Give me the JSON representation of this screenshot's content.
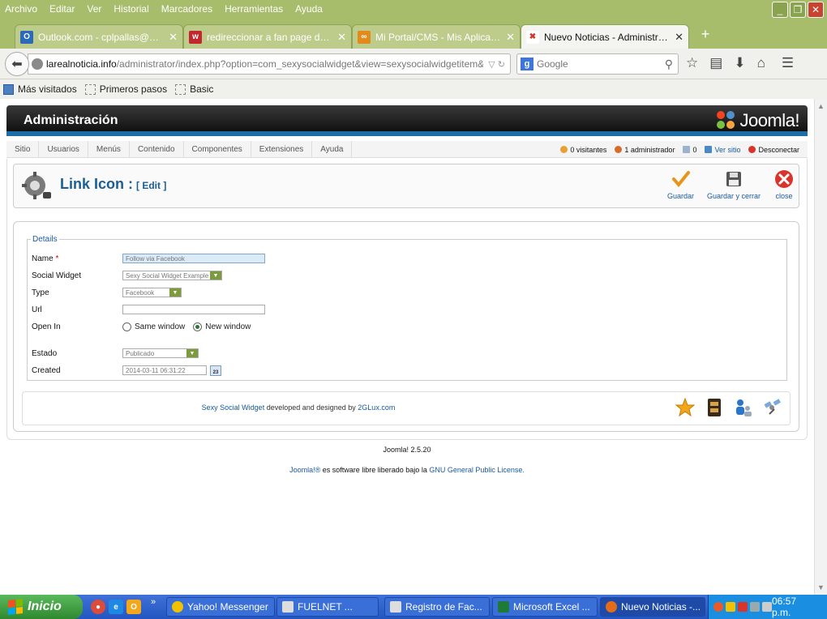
{
  "browser": {
    "menu": [
      "Archivo",
      "Editar",
      "Ver",
      "Historial",
      "Marcadores",
      "Herramientas",
      "Ayuda"
    ],
    "window_buttons": {
      "minimize": "_",
      "maximize": "❐",
      "close": "✕"
    },
    "tabs": [
      {
        "title": "Outlook.com - cplpallas@hot...",
        "icon_color": "#2a6ab8",
        "icon_text": "O"
      },
      {
        "title": "redireccionar a fan page desd...",
        "icon_color": "#c3282e",
        "icon_text": "w"
      },
      {
        "title": "Mi Portal/CMS - Mis Aplicacion...",
        "icon_color": "#e28a1c",
        "icon_text": "∞"
      },
      {
        "title": "Nuevo Noticias - Administraci...",
        "icon_color": "#ffffff",
        "icon_text": "✖"
      }
    ],
    "new_tab": "+",
    "url_host": "larealnoticia.info",
    "url_path": "/administrator/index.php?option=com_sexysocialwidget&view=sexysocialwidgetitem&layout=e",
    "search_placeholder": "Google",
    "bookmarks": [
      "Más visitados",
      "Primeros pasos",
      "Basic"
    ]
  },
  "joomla": {
    "header_title": "Administración",
    "logo_text": "Joomla!",
    "menu": [
      "Sitio",
      "Usuarios",
      "Menús",
      "Contenido",
      "Componentes",
      "Extensiones",
      "Ayuda"
    ],
    "status": {
      "visitors": "0 visitantes",
      "admins": "1 administrador",
      "messages": "0",
      "view_site": "Ver sitio",
      "logout": "Desconectar"
    },
    "page_title": "Link Icon :",
    "page_subtitle": "[ Edit ]",
    "toolbar": {
      "save": "Guardar",
      "save_close": "Guardar y cerrar",
      "close": "close"
    },
    "form": {
      "legend": "Details",
      "name_label": "Name",
      "required_mark": "*",
      "name_value": "Follow via Facebook",
      "widget_label": "Social Widget",
      "widget_value": "Sexy Social Widget Example",
      "type_label": "Type",
      "type_value": "Facebook",
      "url_label": "Url",
      "url_value": "",
      "openin_label": "Open In",
      "openin_same": "Same window",
      "openin_new": "New window",
      "estado_label": "Estado",
      "estado_value": "Publicado",
      "created_label": "Created",
      "created_value": "2014-03-11 06:31:22",
      "calendar_text": "23"
    },
    "credits": {
      "product": "Sexy Social Widget",
      "middle": " developed and designed by ",
      "author": "2GLux.com"
    },
    "footer_version": "Joomla! 2.5.20",
    "footer_license_start": "Joomla!® ",
    "footer_license_middle": "es software libre liberado bajo la ",
    "footer_license_link": "GNU General Public License",
    "footer_license_end": "."
  },
  "taskbar": {
    "start_label": "Inicio",
    "quick_more": "»",
    "tasks": [
      {
        "label": "Yahoo! Messenger",
        "icon_color": "#f2c200"
      },
      {
        "label": "FUELNET        ...",
        "icon_color": "#dddddd"
      },
      {
        "label": "Registro de Fac...",
        "icon_color": "#dddddd"
      },
      {
        "label": "Microsoft Excel ...",
        "icon_color": "#1f7a3a"
      },
      {
        "label": "Nuevo Noticias -...",
        "icon_color": "#e36c1a"
      }
    ],
    "clock": "06:57 p.m."
  }
}
